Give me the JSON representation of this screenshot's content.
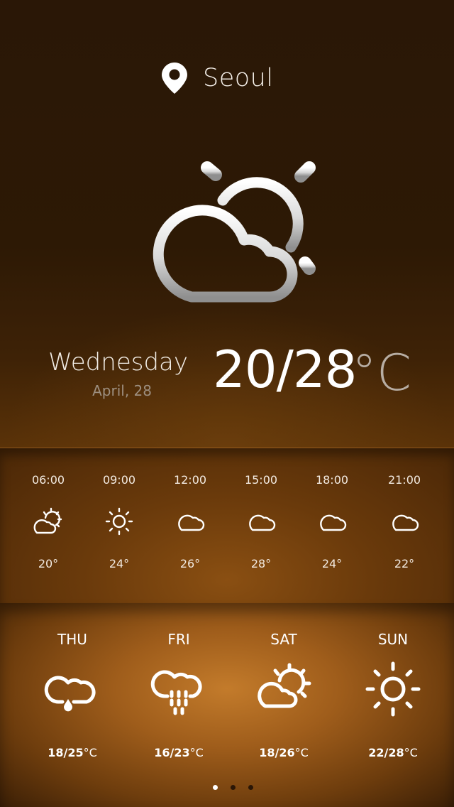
{
  "location": {
    "city": "Seoul",
    "icon": "map-pin-icon"
  },
  "current": {
    "icon": "partly-cloudy-icon",
    "day": "Wednesday",
    "date": "April, 28",
    "temp_range": "20/28",
    "unit": "°C"
  },
  "hourly": [
    {
      "time": "06:00",
      "icon": "partly-cloudy-icon",
      "temp": "20°"
    },
    {
      "time": "09:00",
      "icon": "sun-icon",
      "temp": "24°"
    },
    {
      "time": "12:00",
      "icon": "cloud-icon",
      "temp": "26°"
    },
    {
      "time": "15:00",
      "icon": "cloud-icon",
      "temp": "28°"
    },
    {
      "time": "18:00",
      "icon": "cloud-icon",
      "temp": "24°"
    },
    {
      "time": "21:00",
      "icon": "cloud-icon",
      "temp": "22°"
    }
  ],
  "daily": [
    {
      "day": "THU",
      "icon": "drizzle-icon",
      "range": "18/25",
      "unit": "°C"
    },
    {
      "day": "FRI",
      "icon": "rain-icon",
      "range": "16/23",
      "unit": "°C"
    },
    {
      "day": "SAT",
      "icon": "partly-cloudy-icon",
      "range": "18/26",
      "unit": "°C"
    },
    {
      "day": "SUN",
      "icon": "sun-icon",
      "range": "22/28",
      "unit": "°C"
    }
  ],
  "pager": {
    "pages": 3,
    "active": 1
  },
  "colors": {
    "accent": "#c37b2b",
    "background_dark": "#2a1706",
    "text_muted": "#9d8f80"
  }
}
